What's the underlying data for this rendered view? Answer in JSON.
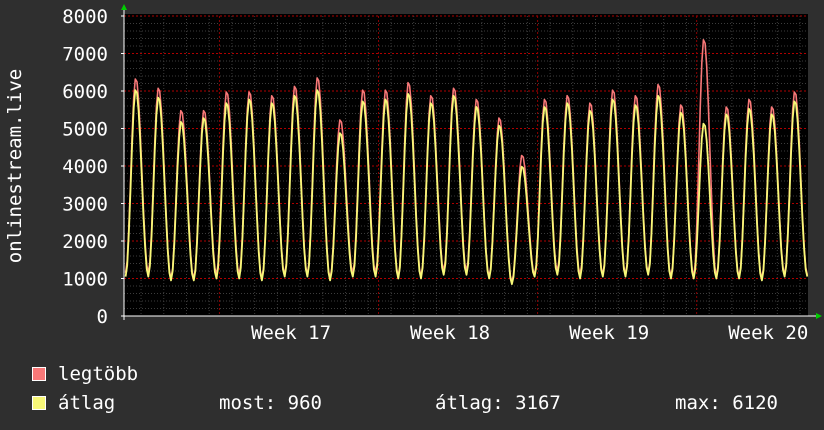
{
  "chart_data": {
    "type": "line",
    "ylabel": "onlinestream.live",
    "ylim": [
      0,
      8000
    ],
    "y_ticks": [
      "0",
      "1000",
      "2000",
      "3000",
      "4000",
      "5000",
      "6000",
      "7000",
      "8000"
    ],
    "x_axis": "week",
    "x_ticks": [
      "Week 17",
      "Week 18",
      "Week 19",
      "Week 20"
    ],
    "x_range_weeks": [
      16.25,
      20.55
    ],
    "grid": true,
    "legend_placement": "bottom-left",
    "background": "#000000",
    "series": [
      {
        "name": "legtöbb",
        "color": "#f87878",
        "daily_peaks": [
          6350,
          6100,
          5500,
          5500,
          6000,
          6000,
          5900,
          6150,
          6380,
          5250,
          6050,
          6050,
          6250,
          5900,
          6100,
          5800,
          5300,
          4300,
          5800,
          5900,
          5700,
          6050,
          5900,
          6200,
          5650,
          7400,
          5600,
          5800,
          5600,
          6000,
          5850,
          5880,
          5500
        ],
        "daily_troughs": [
          1150,
          1150,
          1000,
          1000,
          1100,
          1100,
          1000,
          1100,
          1100,
          1000,
          1150,
          1150,
          1050,
          1050,
          1200,
          1200,
          1050,
          900,
          1100,
          1200,
          1100,
          1100,
          1100,
          1150,
          1050,
          1050,
          1050,
          1050,
          1000,
          1100,
          1100,
          1050,
          950
        ]
      },
      {
        "name": "átlag",
        "color": "#f8f878",
        "daily_peaks": [
          6050,
          5850,
          5200,
          5300,
          5700,
          5800,
          5700,
          5900,
          6050,
          4900,
          5750,
          5800,
          5950,
          5700,
          5900,
          5600,
          5100,
          4000,
          5600,
          5700,
          5500,
          5800,
          5650,
          5900,
          5450,
          5150,
          5400,
          5550,
          5400,
          5750,
          5650,
          5650,
          5200
        ],
        "daily_troughs": [
          1050,
          1050,
          950,
          950,
          1000,
          1000,
          950,
          1050,
          1050,
          950,
          1050,
          1050,
          1000,
          1000,
          1100,
          1100,
          1000,
          850,
          1050,
          1100,
          1000,
          1050,
          1050,
          1100,
          1000,
          1000,
          1000,
          1000,
          950,
          1050,
          1050,
          1000,
          900
        ]
      }
    ]
  },
  "legend": {
    "max_label": "legtöbb",
    "avg_label": "átlag",
    "most_text": "most: 960",
    "avg_text": "átlag: 3167",
    "max_text": "max: 6120"
  },
  "colors": {
    "grid": "#8a0000",
    "axis": "#ffffff",
    "arrow": "#00cc00",
    "text": "#ffffff"
  }
}
